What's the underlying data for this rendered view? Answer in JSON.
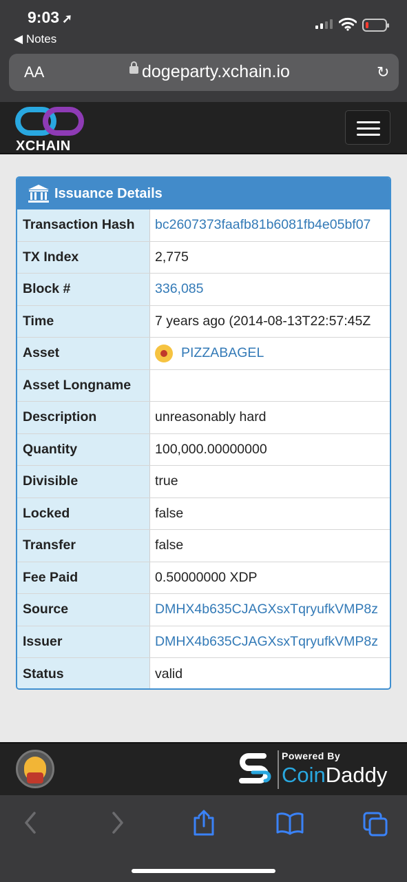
{
  "statusbar": {
    "time": "9:03",
    "back_label": "Notes"
  },
  "browser": {
    "text_size_label": "AA",
    "url": "dogeparty.xchain.io"
  },
  "header": {
    "logo_text": "XCHAIN"
  },
  "panel": {
    "title": "Issuance Details",
    "rows": [
      {
        "label": "Transaction Hash",
        "value": "bc2607373faafb81b6081fb4e05bf07"
      },
      {
        "label": "TX Index",
        "value": "2,775"
      },
      {
        "label": "Block #",
        "value": "336,085"
      },
      {
        "label": "Time",
        "value": "7 years ago (2014-08-13T22:57:45Z"
      },
      {
        "label": "Asset",
        "value": "PIZZABAGEL"
      },
      {
        "label": "Asset Longname",
        "value": ""
      },
      {
        "label": "Description",
        "value": "unreasonably hard"
      },
      {
        "label": "Quantity",
        "value": "100,000.00000000"
      },
      {
        "label": "Divisible",
        "value": "true"
      },
      {
        "label": "Locked",
        "value": "false"
      },
      {
        "label": "Transfer",
        "value": "false"
      },
      {
        "label": "Fee Paid",
        "value": "0.50000000 XDP"
      },
      {
        "label": "Source",
        "value": "DMHX4b635CJAGXsxTqryufkVMP8z"
      },
      {
        "label": "Issuer",
        "value": "DMHX4b635CJAGXsxTqryufkVMP8z"
      },
      {
        "label": "Status",
        "value": "valid"
      }
    ]
  },
  "footer": {
    "powered_by": "Powered By",
    "brand_a": "Coin",
    "brand_b": "Daddy"
  },
  "colors": {
    "accent": "#428bca",
    "link": "#337ab7",
    "key_bg": "#d9edf7",
    "ios_blue": "#3a82f7"
  }
}
